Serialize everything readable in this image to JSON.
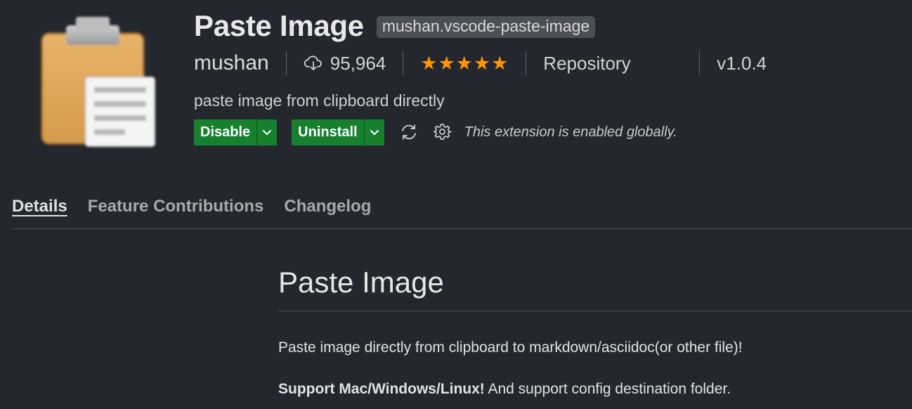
{
  "extension": {
    "name": "Paste Image",
    "identifier": "mushan.vscode-paste-image",
    "publisher": "mushan",
    "install_count": "95,964",
    "rating_stars": 5,
    "stars_text": "★★★★★",
    "repository_label": "Repository",
    "version": "v1.0.4",
    "description": "paste image from clipboard directly",
    "icon": "clipboard-icon"
  },
  "actions": {
    "disable_label": "Disable",
    "uninstall_label": "Uninstall",
    "sync_icon": "sync-icon",
    "settings_icon": "gear-icon",
    "status_message": "This extension is enabled globally."
  },
  "tabs": [
    {
      "label": "Details",
      "active": true
    },
    {
      "label": "Feature Contributions",
      "active": false
    },
    {
      "label": "Changelog",
      "active": false
    }
  ],
  "readme": {
    "title": "Paste Image",
    "paragraph1": "Paste image directly from clipboard to markdown/asciidoc(or other file)!",
    "paragraph2_bold": "Support Mac/Windows/Linux!",
    "paragraph2_rest": " And support config destination folder."
  },
  "colors": {
    "background": "#24282e",
    "button_green": "#16802f",
    "star": "#ff9500",
    "badge": "#4b4f56"
  }
}
